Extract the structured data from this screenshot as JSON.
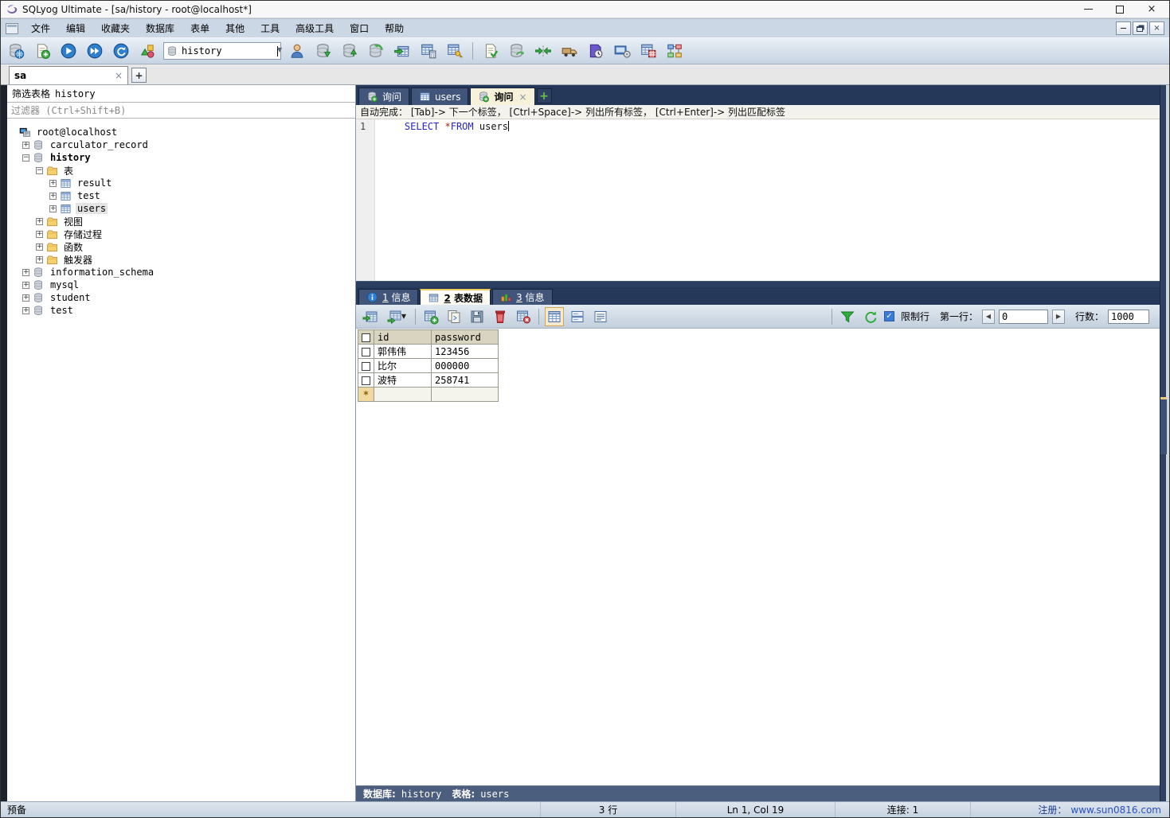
{
  "ui": {
    "close_glyph": "×",
    "add_glyph": "+",
    "caret_down_glyph": "▼",
    "prev_glyph": "◀",
    "next_glyph": "▶",
    "checkmark_glyph": "✓"
  },
  "window": {
    "title": "SQLyog Ultimate - [sa/history - root@localhost*]",
    "controls": [
      "minimize-icon",
      "maximize-icon",
      "close-icon"
    ]
  },
  "menus": [
    "文件",
    "编辑",
    "收藏夹",
    "数据库",
    "表单",
    "其他",
    "工具",
    "高级工具",
    "窗口",
    "帮助"
  ],
  "toolbar": {
    "database_value": "history",
    "items": [
      {
        "type": "button",
        "icon": "connection-manager-icon"
      },
      {
        "type": "button",
        "icon": "new-query-editor-icon"
      },
      {
        "type": "button",
        "icon": "execute-query-icon"
      },
      {
        "type": "button",
        "icon": "execute-all-queries-icon"
      },
      {
        "type": "button",
        "icon": "refresh-object-browser-icon"
      },
      {
        "type": "button",
        "icon": "query-builder-icon"
      },
      {
        "type": "select"
      },
      {
        "type": "button",
        "icon": "user-manager-icon"
      },
      {
        "type": "button",
        "icon": "backup-database-icon"
      },
      {
        "type": "button",
        "icon": "restore-database-icon"
      },
      {
        "type": "button",
        "icon": "copy-database-icon"
      },
      {
        "type": "button",
        "icon": "import-external-data-icon"
      },
      {
        "type": "button",
        "icon": "table-maintenance-icon"
      },
      {
        "type": "button",
        "icon": "manage-indexes-icon"
      },
      {
        "type": "sep"
      },
      {
        "type": "button",
        "icon": "format-query-icon"
      },
      {
        "type": "button",
        "icon": "database-synchronization-icon"
      },
      {
        "type": "button",
        "icon": "data-compare-icon"
      },
      {
        "type": "button",
        "icon": "data-migration-icon"
      },
      {
        "type": "button",
        "icon": "scheduled-backup-icon"
      },
      {
        "type": "button",
        "icon": "notification-services-icon"
      },
      {
        "type": "button",
        "icon": "flush-tools-icon"
      },
      {
        "type": "button",
        "icon": "schema-designer-icon"
      }
    ]
  },
  "connection_tabs": [
    {
      "label": "sa",
      "closable": true
    }
  ],
  "sidebar": {
    "filter_caption_label": "筛选表格",
    "filter_caption_value": "history",
    "filter_placeholder": "过滤器 (Ctrl+Shift+B)",
    "tree": [
      {
        "label": "root@localhost",
        "depth": 0,
        "icon": "server-icon",
        "expander": "none"
      },
      {
        "label": "carculator_record",
        "depth": 1,
        "icon": "database-icon",
        "expander": "plus"
      },
      {
        "label": "history",
        "depth": 1,
        "icon": "database-icon",
        "expander": "minus",
        "bold": true
      },
      {
        "label": "表",
        "depth": 2,
        "icon": "folder-icon",
        "expander": "minus"
      },
      {
        "label": "result",
        "depth": 3,
        "icon": "table-icon",
        "expander": "plus"
      },
      {
        "label": "test",
        "depth": 3,
        "icon": "table-icon",
        "expander": "plus"
      },
      {
        "label": "users",
        "depth": 3,
        "icon": "table-icon",
        "expander": "plus",
        "selected": true
      },
      {
        "label": "视图",
        "depth": 2,
        "icon": "folder-icon",
        "expander": "plus"
      },
      {
        "label": "存储过程",
        "depth": 2,
        "icon": "folder-icon",
        "expander": "plus"
      },
      {
        "label": "函数",
        "depth": 2,
        "icon": "folder-icon",
        "expander": "plus"
      },
      {
        "label": "触发器",
        "depth": 2,
        "icon": "folder-icon",
        "expander": "plus"
      },
      {
        "label": "information_schema",
        "depth": 1,
        "icon": "database-icon",
        "expander": "plus"
      },
      {
        "label": "mysql",
        "depth": 1,
        "icon": "database-icon",
        "expander": "plus"
      },
      {
        "label": "student",
        "depth": 1,
        "icon": "database-icon",
        "expander": "plus"
      },
      {
        "label": "test",
        "depth": 1,
        "icon": "database-icon",
        "expander": "plus"
      }
    ]
  },
  "query_tabs": [
    {
      "label": "询问",
      "icon": "query-tab-icon",
      "active": false,
      "closable": false
    },
    {
      "label": "users",
      "icon": "table-tab-icon",
      "active": false,
      "closable": false
    },
    {
      "label": "询问",
      "icon": "query-tab-icon",
      "active": true,
      "closable": true
    }
  ],
  "editor": {
    "hint": "自动完成： [Tab]-> 下一个标签， [Ctrl+Space]-> 列出所有标签， [Ctrl+Enter]-> 列出匹配标签",
    "line_number": "1",
    "indent": "    ",
    "sql": {
      "kw_select": "SELECT",
      "sp1": " ",
      "star": "*",
      "kw_from": "FROM",
      "sp2": " ",
      "table": "users"
    }
  },
  "result_tabs": [
    {
      "num": "1",
      "text": "信息",
      "icon": "info-icon",
      "active": false
    },
    {
      "num": "2",
      "text": "表数据",
      "icon": "table-data-icon",
      "active": true
    },
    {
      "num": "3",
      "text": "信息",
      "icon": "query-info-icon",
      "active": false
    }
  ],
  "result_toolbar": {
    "left_icons": [
      "export-resultset-icon",
      "grid-export-options-icon",
      "add-new-row-icon",
      "duplicate-row-icon",
      "save-changes-icon",
      "delete-row-icon",
      "cancel-changes-icon"
    ],
    "view_icons": [
      {
        "icon": "grid-view-icon",
        "active": true
      },
      {
        "icon": "form-view-icon",
        "active": false
      },
      {
        "icon": "text-view-icon",
        "active": false
      }
    ],
    "filter_icon": "filter-icon",
    "refresh_icon": "refresh-grid-icon",
    "limit_checked": true,
    "limit_label": "限制行",
    "first_row_label": "第一行：",
    "first_row_value": "0",
    "rows_label": "行数：",
    "rows_value": "1000"
  },
  "grid": {
    "columns": [
      "id",
      "password"
    ],
    "rows": [
      [
        "郭伟伟",
        "123456"
      ],
      [
        "比尔",
        "000000"
      ],
      [
        "波特",
        "258741"
      ]
    ],
    "new_row_marker": "*"
  },
  "result_status": {
    "db_label": "数据库:",
    "db_value": "history",
    "table_label": "表格:",
    "table_value": "users"
  },
  "statusbar": {
    "ready": "预备",
    "row_count": "3 行",
    "cursor_position": "Ln 1, Col 19",
    "connections": "连接: 1",
    "register_label": "注册：",
    "register_url": "www.sun0816.com"
  }
}
